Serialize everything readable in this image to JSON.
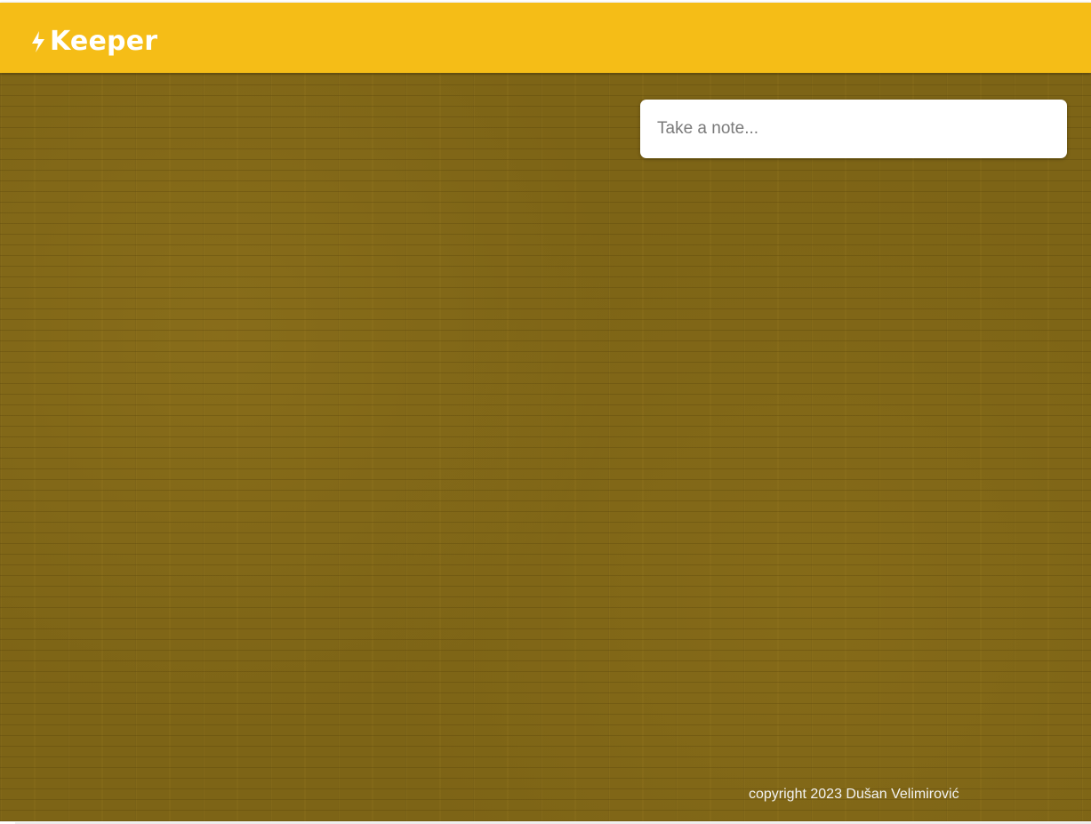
{
  "header": {
    "title": "Keeper",
    "icon": "lightning-bolt-icon",
    "background_color": "#f5bd17"
  },
  "note_input": {
    "value": "",
    "placeholder": "Take a note..."
  },
  "footer": {
    "text": "copyright 2023 Dušan Velimirović"
  },
  "background": {
    "pattern": "brick-wall",
    "color": "#7d6416"
  }
}
